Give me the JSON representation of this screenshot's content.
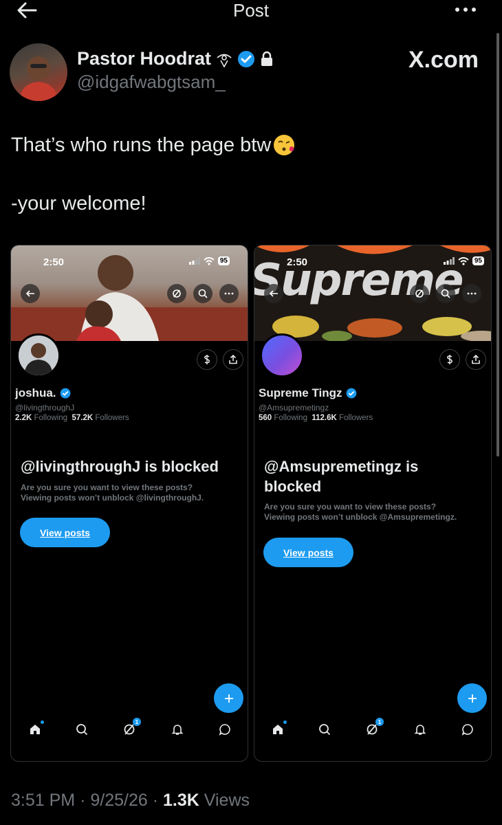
{
  "header": {
    "title": "Post"
  },
  "author": {
    "name": "Pastor Hoodrat",
    "handle": "@idgafwabgtsam_",
    "badge_color": "#1d9bf0"
  },
  "source_label": "X.com",
  "tweet": {
    "line1": "That’s who runs the page btw",
    "line2": "-your welcome!",
    "emoji": "kissing-face-icon"
  },
  "screenshots": [
    {
      "time": "2:50",
      "battery": "95",
      "display_name": "joshua.",
      "handle": "@livingthroughJ",
      "following_count": "2.2K",
      "following_label": "Following",
      "followers_count": "57.2K",
      "followers_label": "Followers",
      "blocked_title": "@livingthroughJ is blocked",
      "blocked_line1": "Are you sure you want to view these posts?",
      "blocked_line2": "Viewing posts won’t unblock @livingthroughJ.",
      "button_label": "View posts",
      "notification_count": "1"
    },
    {
      "time": "2:50",
      "battery": "95",
      "banner_text": "Supreme",
      "display_name": "Supreme Tingz",
      "handle": "@Amsupremetingz",
      "following_count": "560",
      "following_label": "Following",
      "followers_count": "112.6K",
      "followers_label": "Followers",
      "blocked_title": "@Amsupremetingz is blocked",
      "blocked_line1": "Are you sure you want to view these posts?",
      "blocked_line2": "Viewing posts won’t unblock @Amsupremetingz.",
      "button_label": "View posts",
      "notification_count": "1"
    }
  ],
  "footer": {
    "time": "3:51 PM",
    "date": "9/25/26",
    "views_count": "1.3K",
    "views_label": "Views"
  },
  "colors": {
    "accent": "#1d9bf0",
    "muted": "#71767b",
    "text": "#e7e9ea",
    "background": "#000000"
  }
}
